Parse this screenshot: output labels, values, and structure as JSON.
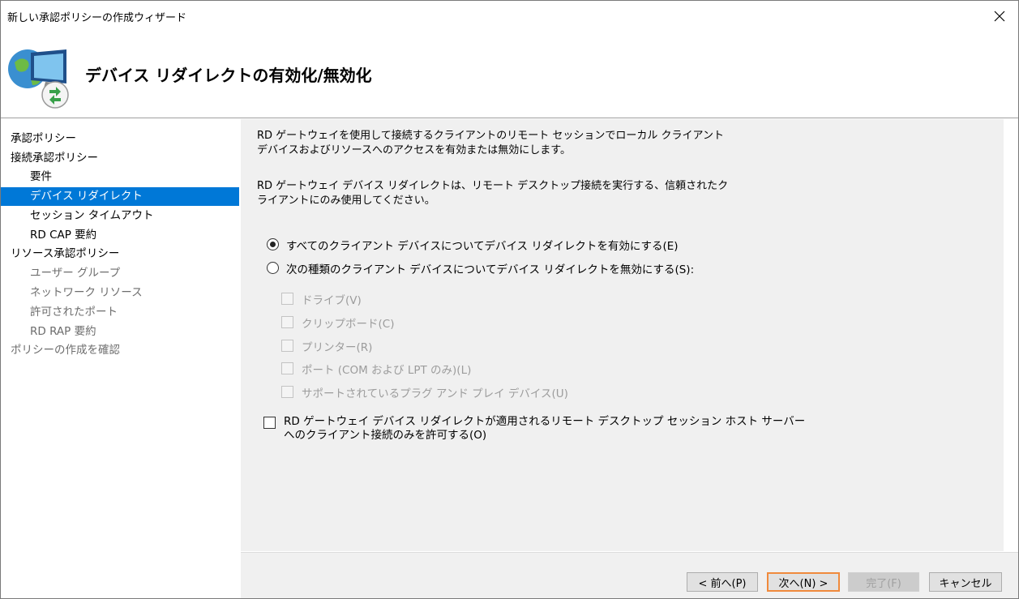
{
  "window": {
    "title": "新しい承認ポリシーの作成ウィザード"
  },
  "header": {
    "title": "デバイス リダイレクトの有効化/無効化",
    "icon": "remote-desktop-gateway-icon"
  },
  "nav": {
    "items": [
      {
        "label": "承認ポリシー",
        "level": "top",
        "state": "normal"
      },
      {
        "label": "接続承認ポリシー",
        "level": "top",
        "state": "normal"
      },
      {
        "label": "要件",
        "level": "sub",
        "state": "normal"
      },
      {
        "label": "デバイス リダイレクト",
        "level": "sub",
        "state": "selected"
      },
      {
        "label": "セッション タイムアウト",
        "level": "sub",
        "state": "normal"
      },
      {
        "label": "RD CAP 要約",
        "level": "sub",
        "state": "normal"
      },
      {
        "label": "リソース承認ポリシー",
        "level": "top",
        "state": "normal"
      },
      {
        "label": "ユーザー グループ",
        "level": "sub",
        "state": "disabled"
      },
      {
        "label": "ネットワーク リソース",
        "level": "sub",
        "state": "disabled"
      },
      {
        "label": "許可されたポート",
        "level": "sub",
        "state": "disabled"
      },
      {
        "label": "RD RAP 要約",
        "level": "sub",
        "state": "disabled"
      },
      {
        "label": "ポリシーの作成を確認",
        "level": "top",
        "state": "disabled"
      }
    ],
    "selected_color": "#0078d7"
  },
  "content": {
    "para1": "RD ゲートウェイを使用して接続するクライアントのリモート セッションでローカル クライアント デバイスおよびリソースへのアクセスを有効または無効にします。",
    "para2": "RD ゲートウェイ デバイス リダイレクトは、リモート デスクトップ接続を実行する、信頼されたクライアントにのみ使用してください。",
    "radio_enable_all": {
      "label": "すべてのクライアント デバイスについてデバイス リダイレクトを有効にする(E)",
      "checked": true
    },
    "radio_disable_types": {
      "label": "次の種類のクライアント デバイスについてデバイス リダイレクトを無効にする(S):",
      "checked": false
    },
    "device_checkboxes": [
      {
        "label": "ドライブ(V)",
        "checked": false,
        "enabled": false
      },
      {
        "label": "クリップボード(C)",
        "checked": false,
        "enabled": false
      },
      {
        "label": "プリンター(R)",
        "checked": false,
        "enabled": false
      },
      {
        "label": "ポート (COM および LPT のみ)(L)",
        "checked": false,
        "enabled": false
      },
      {
        "label": "サポートされているプラグ アンド プレイ デバイス(U)",
        "checked": false,
        "enabled": false
      }
    ],
    "allow_only_checkbox": {
      "label_line1": "RD ゲートウェイ デバイス リダイレクトが適用されるリモート デスクトップ セッション ホスト サーバー",
      "label_line2": "へのクライアント接続のみを許可する(O)",
      "checked": false
    }
  },
  "footer": {
    "back_label": "< 前へ(P)",
    "next_label": "次へ(N) >",
    "finish_label": "完了(F)",
    "cancel_label": "キャンセル",
    "focus_color": "#f08a3c"
  }
}
